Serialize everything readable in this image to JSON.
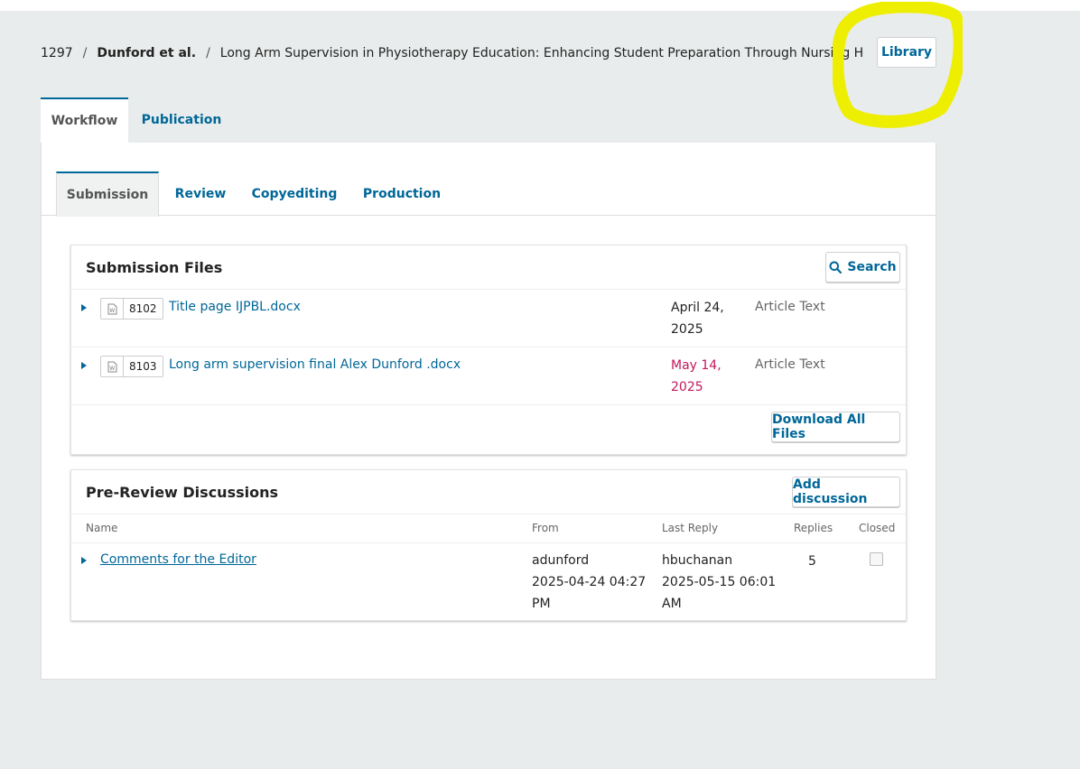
{
  "breadcrumb": {
    "id": "1297",
    "authors": "Dunford et al.",
    "title": "Long Arm Supervision in Physiotherapy Education: Enhancing Student Preparation Through Nursing Home Placements"
  },
  "library_button": "Library",
  "outer_tabs": [
    "Workflow",
    "Publication"
  ],
  "inner_tabs": [
    "Submission",
    "Review",
    "Copyediting",
    "Production"
  ],
  "submission_files": {
    "title": "Submission Files",
    "search_label": "Search",
    "files": [
      {
        "id": "8102",
        "name": "Title page IJPBL.docx",
        "date_line1": "April 24,",
        "date_line2": "2025",
        "type": "Article Text",
        "date_color": "#222222"
      },
      {
        "id": "8103",
        "name": "Long arm supervision final Alex Dunford .docx",
        "date_line1": "May 14,",
        "date_line2": "2025",
        "type": "Article Text",
        "date_color": "#c2185b"
      }
    ],
    "download_all_label": "Download All Files"
  },
  "discussions": {
    "title": "Pre-Review Discussions",
    "add_label": "Add discussion",
    "columns": {
      "name": "Name",
      "from": "From",
      "last_reply": "Last Reply",
      "replies": "Replies",
      "closed": "Closed"
    },
    "rows": [
      {
        "name": "Comments for the Editor",
        "from_user": "adunford",
        "from_date1": "2025-04-24 04:27",
        "from_date2": "PM",
        "reply_user": "hbuchanan",
        "reply_date1": "2025-05-15 06:01",
        "reply_date2": "AM",
        "replies": "5"
      }
    ]
  },
  "colors": {
    "accent": "#006798",
    "highlight": "#eeee00",
    "page_bg": "#e9ecec"
  }
}
